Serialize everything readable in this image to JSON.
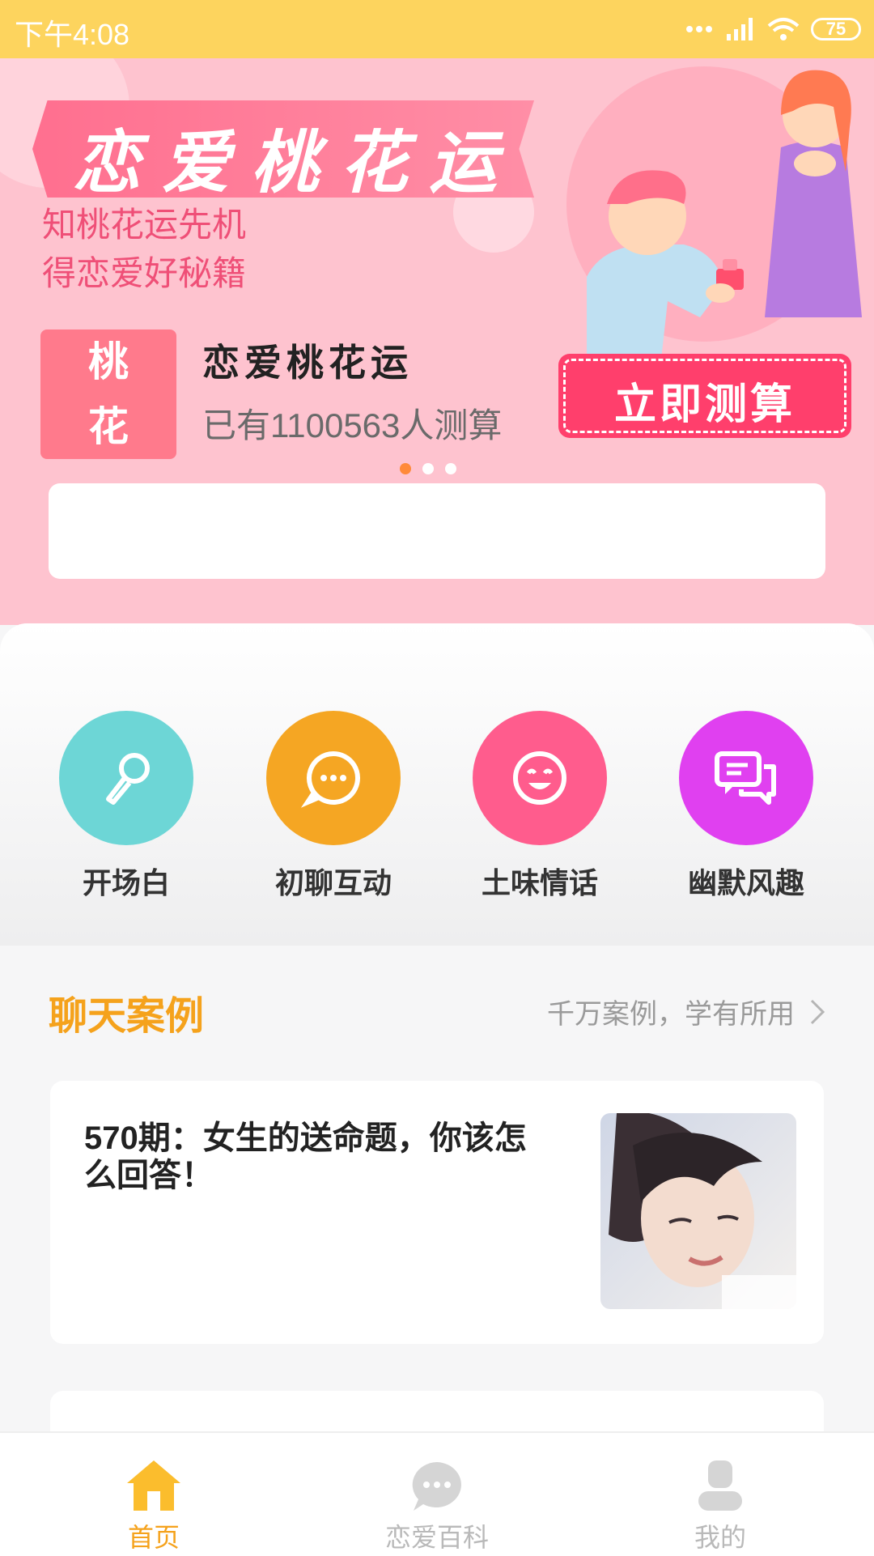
{
  "status": {
    "time": "下午4:08",
    "battery": "75"
  },
  "banner": {
    "headline": "恋爱桃花运",
    "tagline1": "知桃花运先机",
    "tagline2": "得恋爱好秘籍",
    "badge_line1": "桃",
    "badge_line2": "花",
    "product_title": "恋爱桃花运",
    "product_count": "已有1100563人测算",
    "cta_label": "立即测算",
    "carousel_pages": 3,
    "carousel_active": 1
  },
  "categories": [
    {
      "label": "开场白",
      "icon": "microphone-icon",
      "color": "#6dd6d6"
    },
    {
      "label": "初聊互动",
      "icon": "chat-bubble-icon",
      "color": "#f5a623"
    },
    {
      "label": "土味情话",
      "icon": "smile-icon",
      "color": "#ff5c8d"
    },
    {
      "label": "幽默风趣",
      "icon": "messages-icon",
      "color": "#e040f0"
    }
  ],
  "section": {
    "title": "聊天案例",
    "more": "千万案例，学有所用"
  },
  "articles": [
    {
      "title": "570期：女生的送命题，你该怎么回答！"
    }
  ],
  "tabs": [
    {
      "label": "首页",
      "icon": "home-icon",
      "active": true
    },
    {
      "label": "恋爱百科",
      "icon": "chat-icon",
      "active": false
    },
    {
      "label": "我的",
      "icon": "user-icon",
      "active": false
    }
  ],
  "colors": {
    "accent": "#f5a21c",
    "status_bar": "#fdd45e",
    "banner_bg": "#fec3cf",
    "cta": "#ff3f6c"
  }
}
